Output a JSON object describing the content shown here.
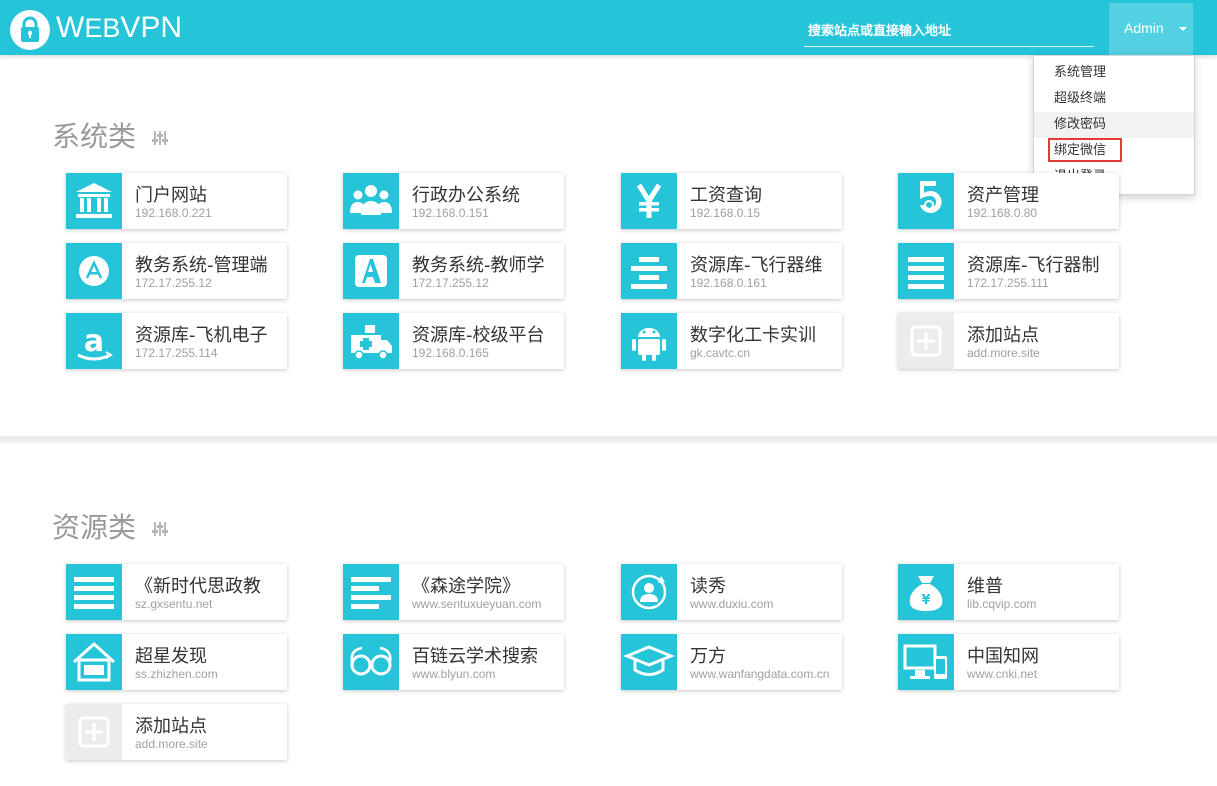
{
  "header": {
    "brand_big": "W",
    "brand_small": "EB",
    "brand_rest": "VPN",
    "search_placeholder": "搜索站点或直接输入地址",
    "user": "Admin"
  },
  "menu": [
    {
      "label": "系统管理"
    },
    {
      "label": "超级终端"
    },
    {
      "label": "修改密码"
    },
    {
      "label": "绑定微信"
    },
    {
      "label": "退出登录"
    }
  ],
  "sections": [
    {
      "title": "系统类",
      "cards": [
        {
          "name": "门户网站",
          "addr": "192.168.0.221",
          "icon": "bank-icon"
        },
        {
          "name": "行政办公系统",
          "addr": "192.168.0.151",
          "icon": "group-icon"
        },
        {
          "name": "工资查询",
          "addr": "192.168.0.15",
          "icon": "yen-icon"
        },
        {
          "name": "资产管理",
          "addr": "192.168.0.80",
          "icon": "number-five-icon"
        },
        {
          "name": "教务系统-管理端",
          "addr": "172.17.255.12",
          "icon": "letter-a-circle-icon"
        },
        {
          "name": "教务系统-教师学",
          "addr": "172.17.255.12",
          "icon": "letter-a-square-icon"
        },
        {
          "name": "资源库-飞行器维",
          "addr": "192.168.0.161",
          "icon": "align-center-icon"
        },
        {
          "name": "资源库-飞行器制",
          "addr": "172.17.255.111",
          "icon": "stack-icon"
        },
        {
          "name": "资源库-飞机电子",
          "addr": "172.17.255.114",
          "icon": "amazon-icon"
        },
        {
          "name": "资源库-校级平台",
          "addr": "192.168.0.165",
          "icon": "ambulance-icon"
        },
        {
          "name": "数字化工卡实训",
          "addr": "gk.cavtc.cn",
          "icon": "android-icon"
        },
        {
          "name": "添加站点",
          "addr": "add.more.site",
          "icon": "add-icon"
        }
      ]
    },
    {
      "title": "资源类",
      "cards": [
        {
          "name": "《新时代思政教",
          "addr": "sz.gxsentu.net",
          "icon": "lines-icon"
        },
        {
          "name": "《森途学院》",
          "addr": "www.sentuxueyuan.com",
          "icon": "align-left-icon"
        },
        {
          "name": "读秀",
          "addr": "www.duxiu.com",
          "icon": "user-sync-icon"
        },
        {
          "name": "维普",
          "addr": "lib.cqvip.com",
          "icon": "money-bag-icon"
        },
        {
          "name": "超星发现",
          "addr": "ss.zhizhen.com",
          "icon": "house-icon"
        },
        {
          "name": "百链云学术搜索",
          "addr": "www.blyun.com",
          "icon": "glasses-icon"
        },
        {
          "name": "万方",
          "addr": "www.wanfangdata.com.cn",
          "icon": "graduation-cap-icon"
        },
        {
          "name": "中国知网",
          "addr": "www.cnki.net",
          "icon": "devices-icon"
        },
        {
          "name": "添加站点",
          "addr": "add.more.site",
          "icon": "add-icon"
        }
      ]
    }
  ]
}
